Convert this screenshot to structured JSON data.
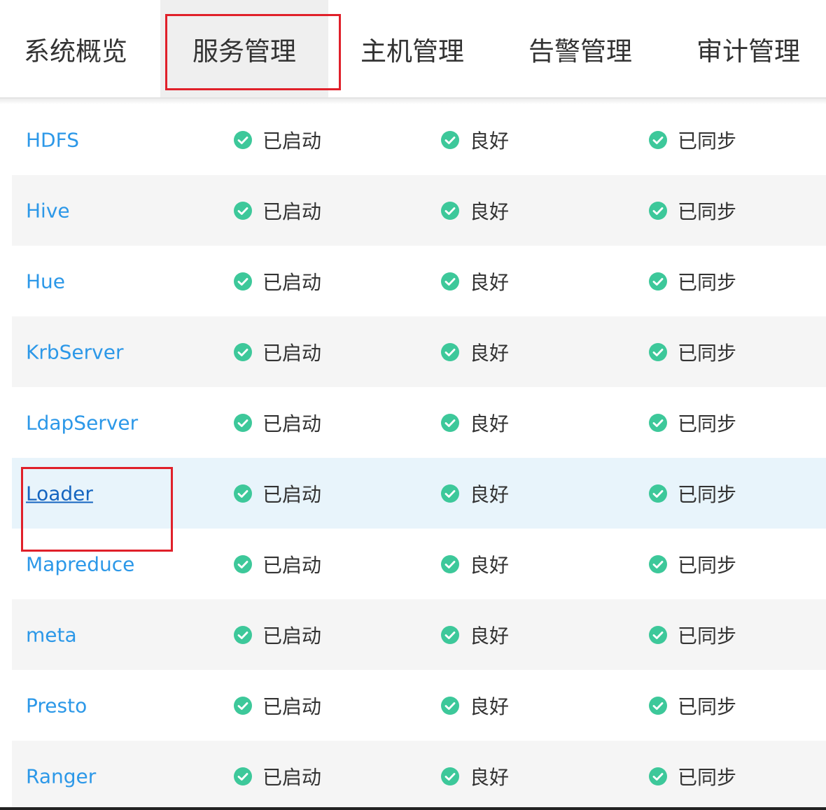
{
  "nav": {
    "tabs": [
      {
        "label": "系统概览",
        "active": false
      },
      {
        "label": "服务管理",
        "active": true
      },
      {
        "label": "主机管理",
        "active": false
      },
      {
        "label": "告警管理",
        "active": false
      },
      {
        "label": "审计管理",
        "active": false
      }
    ]
  },
  "services": [
    {
      "name": "HDFS",
      "running": "已启动",
      "health": "良好",
      "config": "已同步"
    },
    {
      "name": "Hive",
      "running": "已启动",
      "health": "良好",
      "config": "已同步"
    },
    {
      "name": "Hue",
      "running": "已启动",
      "health": "良好",
      "config": "已同步"
    },
    {
      "name": "KrbServer",
      "running": "已启动",
      "health": "良好",
      "config": "已同步"
    },
    {
      "name": "LdapServer",
      "running": "已启动",
      "health": "良好",
      "config": "已同步"
    },
    {
      "name": "Loader",
      "running": "已启动",
      "health": "良好",
      "config": "已同步"
    },
    {
      "name": "Mapreduce",
      "running": "已启动",
      "health": "良好",
      "config": "已同步"
    },
    {
      "name": "meta",
      "running": "已启动",
      "health": "良好",
      "config": "已同步"
    },
    {
      "name": "Presto",
      "running": "已启动",
      "health": "良好",
      "config": "已同步"
    },
    {
      "name": "Ranger",
      "running": "已启动",
      "health": "良好",
      "config": "已同步"
    }
  ],
  "icons": {
    "status": "check-circle-icon"
  },
  "colors": {
    "link": "#2c98e8",
    "link_hover": "#1565c0",
    "status_ok": "#3dc89a",
    "highlight": "#e0202a",
    "active_tab_bg": "#efefef"
  }
}
